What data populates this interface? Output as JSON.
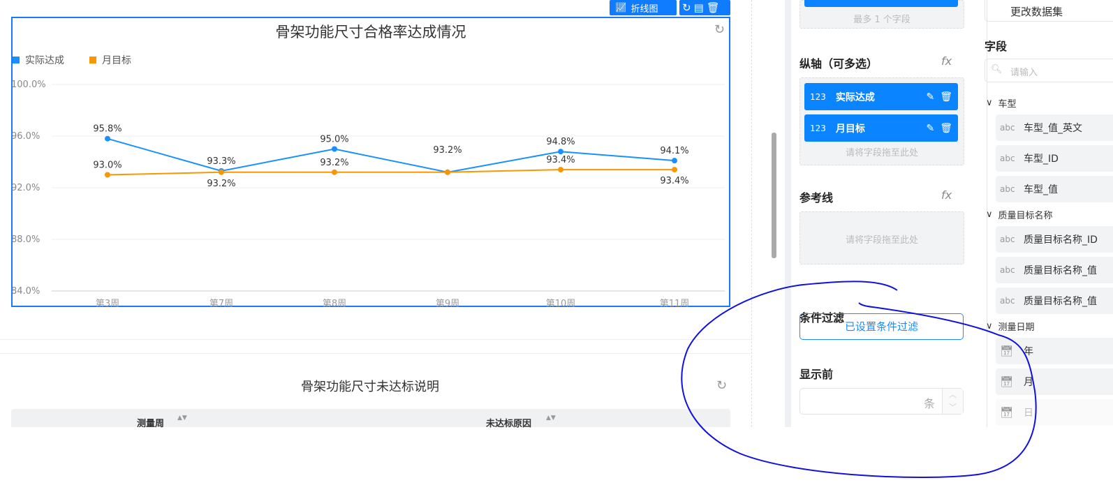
{
  "toolbar": {
    "chart_type_label": "折线图",
    "icons": [
      "line-chart-icon",
      "refresh-icon",
      "table-icon",
      "trash-icon"
    ]
  },
  "chart_card": {
    "refresh_icon": "refresh-icon"
  },
  "chart_data": {
    "type": "line",
    "title": "骨架功能尺寸合格率达成情况",
    "categories": [
      "第3周",
      "第7周",
      "第8周",
      "第9周",
      "第10周",
      "第11周"
    ],
    "yticks": [
      "100.0%",
      "96.0%",
      "92.0%",
      "88.0%",
      "84.0%"
    ],
    "ylim": [
      84,
      100
    ],
    "grid": true,
    "legend_position": "top-left",
    "series": [
      {
        "name": "实际达成",
        "color": "#1890ff",
        "values": [
          95.8,
          93.3,
          95.0,
          93.2,
          94.8,
          94.1
        ],
        "labels": [
          "95.8%",
          "93.3%",
          "95.0%",
          "93.2%",
          "94.8%",
          "94.1%"
        ]
      },
      {
        "name": "月目标",
        "color": "#fa9600",
        "values": [
          93.0,
          93.2,
          93.2,
          93.2,
          93.4,
          93.4
        ],
        "labels": [
          "93.0%",
          "93.2%",
          "93.2%",
          "",
          "93.4%",
          "93.4%"
        ]
      }
    ]
  },
  "table_card": {
    "title": "骨架功能尺寸未达标说明",
    "columns": [
      "测量周",
      "未达标原因"
    ]
  },
  "config": {
    "x_hint": "最多 1 个字段",
    "y_axis_title": "纵轴（可多选）",
    "fx": "fx",
    "y_fields": [
      {
        "type": "123",
        "label": "实际达成"
      },
      {
        "type": "123",
        "label": "月目标"
      }
    ],
    "drop_hint": "请将字段拖至此处",
    "ref_title": "参考线",
    "filter_title": "条件过滤",
    "filter_button": "已设置条件过滤",
    "topn_title": "显示前",
    "topn_unit": "条",
    "topn_value": ""
  },
  "fields_panel": {
    "change_dataset": "更改数据集",
    "title": "字段",
    "search_placeholder": "请输入",
    "groups": [
      {
        "name": "车型",
        "items": [
          {
            "type": "abc",
            "label": "车型_值_英文"
          },
          {
            "type": "abc",
            "label": "车型_ID"
          },
          {
            "type": "abc",
            "label": "车型_值"
          }
        ]
      },
      {
        "name": "质量目标名称",
        "items": [
          {
            "type": "abc",
            "label": "质量目标名称_ID"
          },
          {
            "type": "abc",
            "label": "质量目标名称_值"
          },
          {
            "type": "abc",
            "label": "质量目标名称_值"
          }
        ]
      },
      {
        "name": "测量日期",
        "items": [
          {
            "type": "date",
            "label": "年"
          },
          {
            "type": "date",
            "label": "月"
          },
          {
            "type": "date",
            "label": "日"
          }
        ]
      }
    ]
  },
  "annotation": {
    "color": "#1010e0"
  }
}
